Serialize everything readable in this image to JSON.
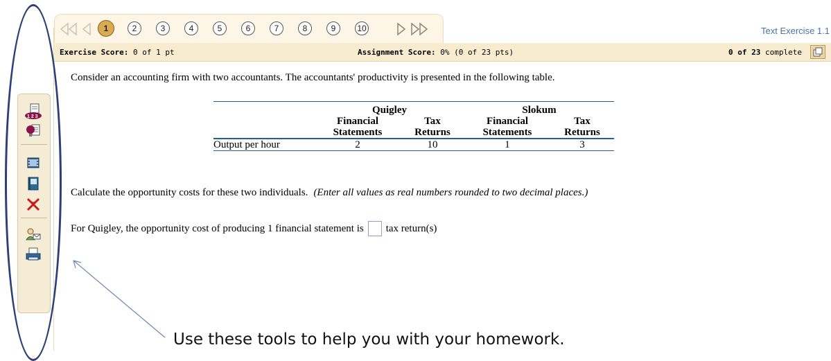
{
  "nav": {
    "questions": [
      "1",
      "2",
      "3",
      "4",
      "5",
      "6",
      "7",
      "8",
      "9",
      "10"
    ],
    "active_index": 0
  },
  "exercise_title": "Text Exercise 1.1",
  "scorebar": {
    "exercise_label": "Exercise Score:",
    "exercise_value": "0 of 1 pt",
    "assignment_label": "Assignment Score:",
    "assignment_value": "0% (0 of 23 pts)",
    "complete_count": "0 of 23",
    "complete_label": "complete"
  },
  "intro": "Consider an accounting firm with two accountants.  The accountants' productivity is presented in the following table.",
  "table": {
    "group_headers": [
      "Quigley",
      "Slokum"
    ],
    "sub_headers": [
      [
        "Financial",
        "Statements"
      ],
      [
        "Tax",
        "Returns"
      ],
      [
        "Financial",
        "Statements"
      ],
      [
        "Tax",
        "Returns"
      ]
    ],
    "row_label": "Output per hour",
    "values": [
      "2",
      "10",
      "1",
      "3"
    ]
  },
  "instruction": "Calculate the opportunity costs for these two individuals.",
  "instruction_note": "(Enter all values as real numbers rounded to two decimal places.)",
  "question_before": "For Quigley, the opportunity cost of producing 1 financial statement is",
  "question_after": "tax return(s)",
  "callout": "Use these tools to help you with your homework.",
  "tools": [
    "question-help-icon",
    "hint-icon",
    "video-icon",
    "textbook-icon",
    "tools-icon",
    "ask-instructor-icon",
    "print-icon"
  ],
  "colors": {
    "accent": "#d9aa52",
    "oval": "#2c3f77",
    "link": "#4a72a9"
  }
}
